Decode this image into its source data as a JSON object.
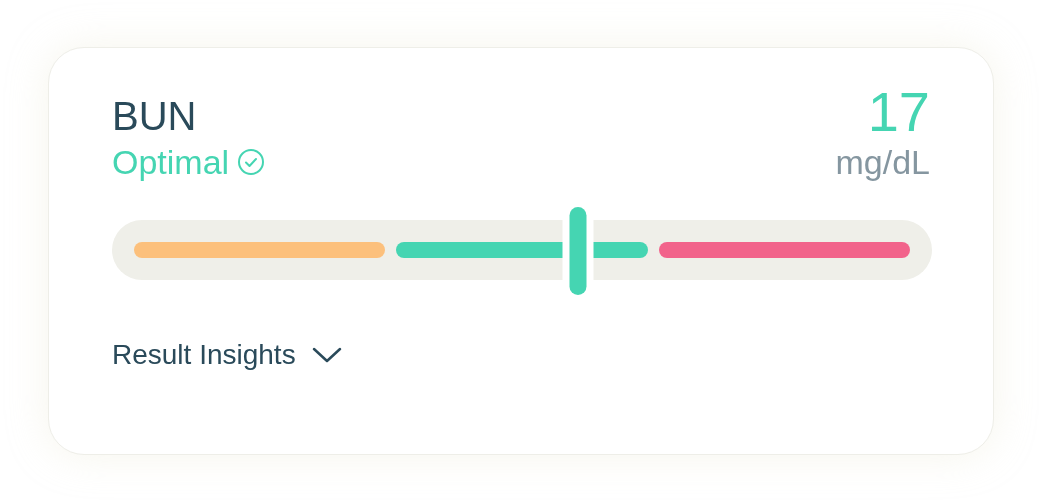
{
  "marker": {
    "name": "BUN",
    "status": "Optimal",
    "value": "17",
    "unit": "mg/dL"
  },
  "range_bar": {
    "segments": [
      {
        "color": "#fcc07c"
      },
      {
        "color": "#45d5b2"
      },
      {
        "color": "#f2638b"
      }
    ]
  },
  "insights": {
    "label": "Result Insights",
    "expanded": false
  }
}
